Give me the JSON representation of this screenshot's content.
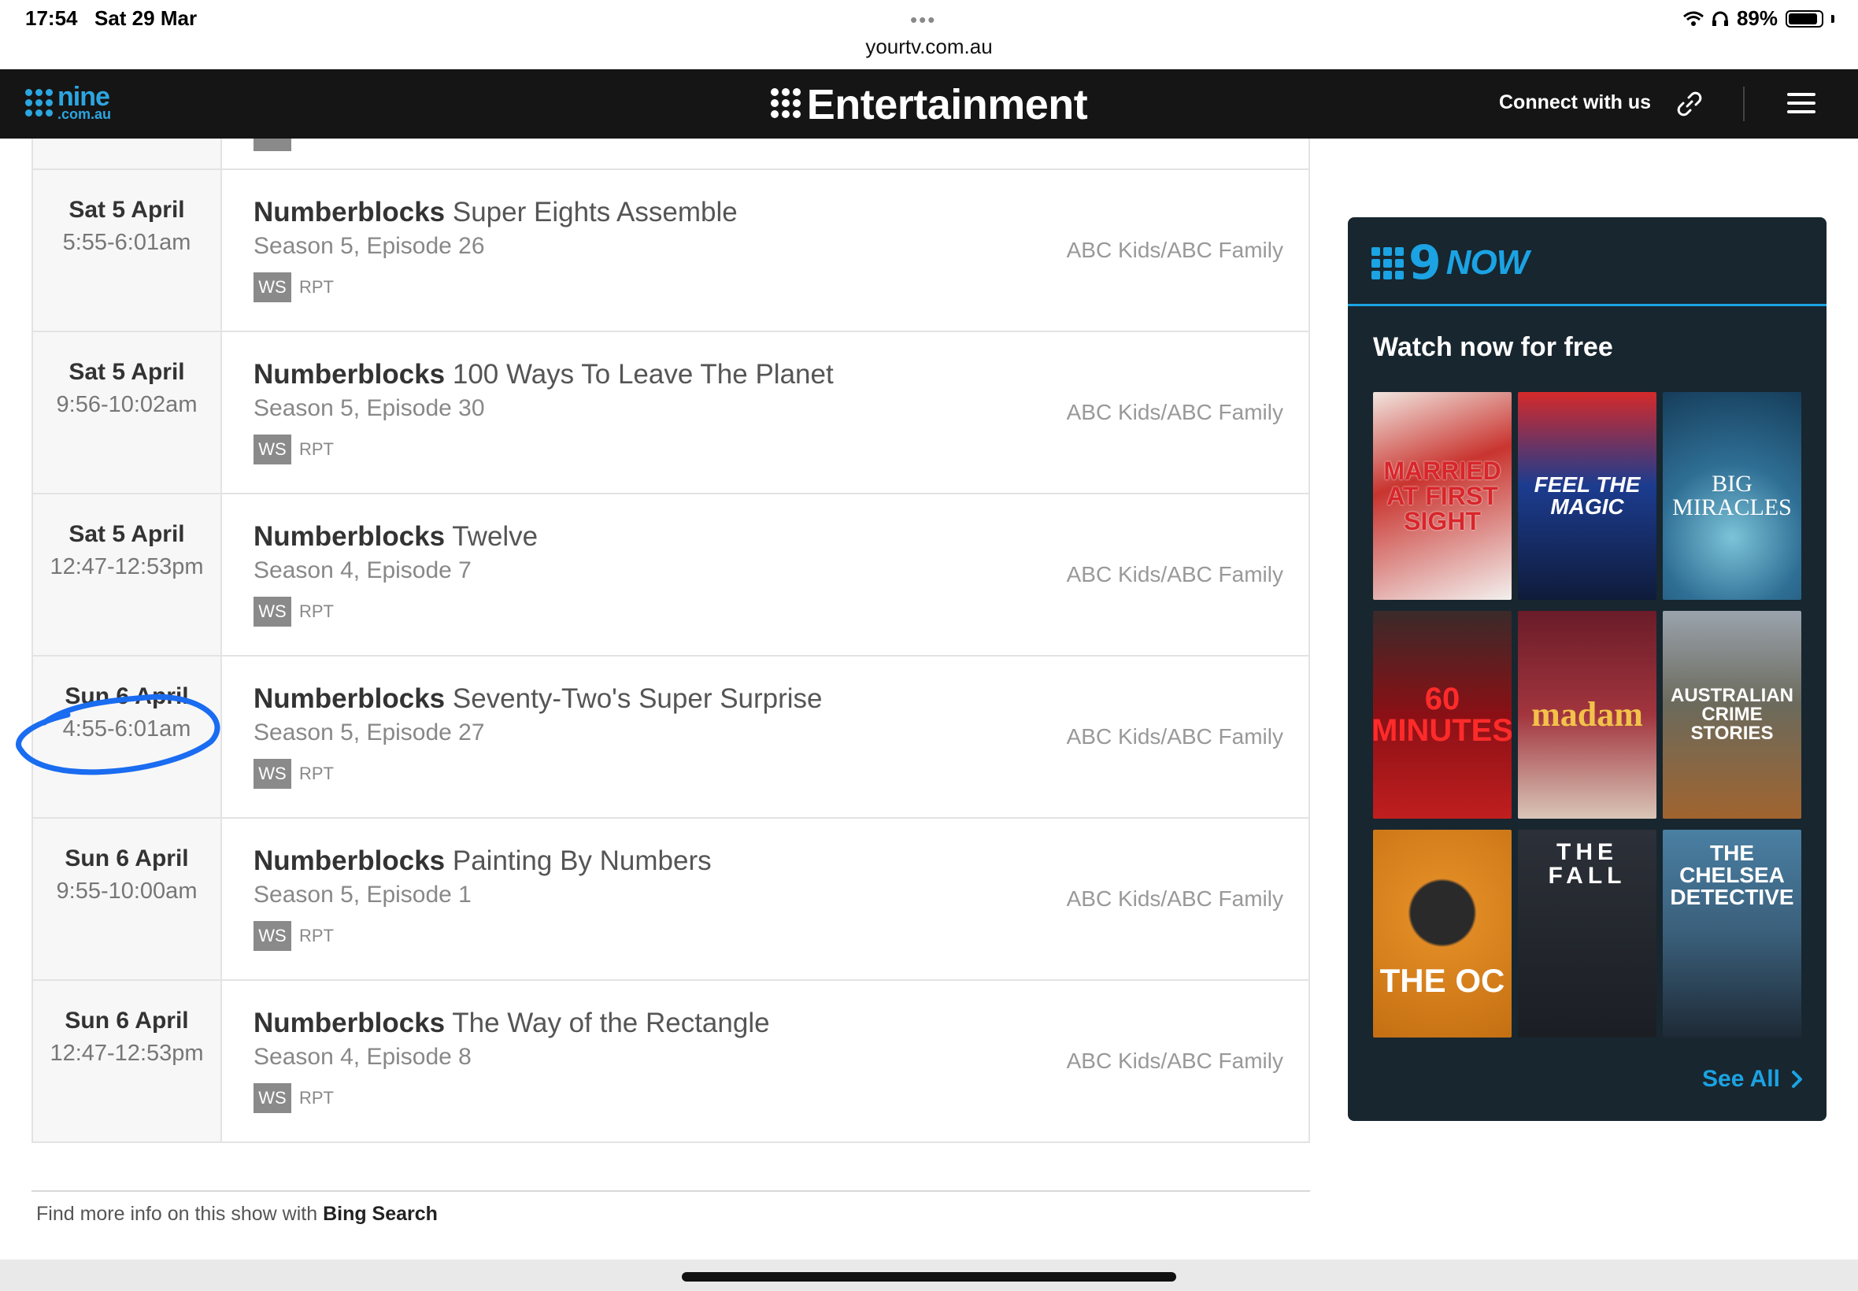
{
  "status_bar": {
    "time": "17:54",
    "date": "Sat 29 Mar",
    "url": "yourtv.com.au",
    "battery": "89%"
  },
  "header": {
    "logo_main": "nine",
    "logo_sub": ".com.au",
    "title": "Entertainment",
    "connect": "Connect with us"
  },
  "listings": [
    {
      "day": "Sat 5 April",
      "time": "5:55-6:01am",
      "show": "Numberblocks",
      "episode": "Super Eights Assemble",
      "season": "Season 5, Episode 26",
      "tag1": "WS",
      "tag2": "RPT",
      "channel": "ABC Kids/ABC Family"
    },
    {
      "day": "Sat 5 April",
      "time": "9:56-10:02am",
      "show": "Numberblocks",
      "episode": "100 Ways To Leave The Planet",
      "season": "Season 5, Episode 30",
      "tag1": "WS",
      "tag2": "RPT",
      "channel": "ABC Kids/ABC Family"
    },
    {
      "day": "Sat 5 April",
      "time": "12:47-12:53pm",
      "show": "Numberblocks",
      "episode": "Twelve",
      "season": "Season 4, Episode 7",
      "tag1": "WS",
      "tag2": "RPT",
      "channel": "ABC Kids/ABC Family"
    },
    {
      "day": "Sun 6 April",
      "time": "4:55-6:01am",
      "show": "Numberblocks",
      "episode": "Seventy-Two's Super Surprise",
      "season": "Season 5, Episode 27",
      "tag1": "WS",
      "tag2": "RPT",
      "channel": "ABC Kids/ABC Family"
    },
    {
      "day": "Sun 6 April",
      "time": "9:55-10:00am",
      "show": "Numberblocks",
      "episode": "Painting By Numbers",
      "season": "Season 5, Episode 1",
      "tag1": "WS",
      "tag2": "RPT",
      "channel": "ABC Kids/ABC Family"
    },
    {
      "day": "Sun 6 April",
      "time": "12:47-12:53pm",
      "show": "Numberblocks",
      "episode": "The Way of the Rectangle",
      "season": "Season 4, Episode 8",
      "tag1": "WS",
      "tag2": "RPT",
      "channel": "ABC Kids/ABC Family"
    }
  ],
  "footer": {
    "prefix": "Find more info on this show with",
    "link": "Bing Search"
  },
  "ninenow": {
    "logo_nine": "9",
    "logo_word": "NOW",
    "heading": "Watch now for free",
    "tiles": [
      {
        "title": "MARRIED AT FIRST SIGHT",
        "bg": "#c9342f"
      },
      {
        "title": "FEEL THE MAGIC",
        "bg": "#1c3c8f"
      },
      {
        "title": "BIG MIRACLES",
        "bg": "#2f6f95"
      },
      {
        "title": "60 MINUTES",
        "bg": "#5a0f12"
      },
      {
        "title": "madam",
        "bg": "#7a2030"
      },
      {
        "title": "AUSTRALIAN CRIME STORIES",
        "bg": "#6b6a5c"
      },
      {
        "title": "THE OC",
        "bg": "#d97f1e"
      },
      {
        "title": "THE FALL",
        "bg": "#1b1e24"
      },
      {
        "title": "THE CHELSEA DETECTIVE",
        "bg": "#3a5f7a"
      }
    ],
    "see_all": "See All"
  }
}
